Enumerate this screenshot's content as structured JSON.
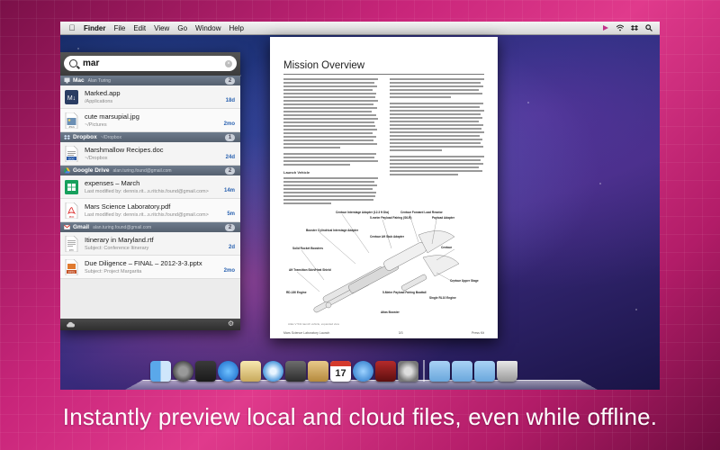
{
  "menubar": {
    "items": [
      "Finder",
      "File",
      "Edit",
      "View",
      "Go",
      "Window",
      "Help"
    ]
  },
  "search": {
    "query": "mar"
  },
  "groups": [
    {
      "name": "Mac",
      "account": "Alan Turing",
      "count": "2",
      "icon": "mac-icon",
      "results": [
        {
          "title": "Marked.app",
          "subtitle": "/Applications",
          "age": "18d",
          "icon": "app-icon"
        },
        {
          "title": "cute marsupial.jpg",
          "subtitle": "~/Pictures",
          "age": "2mo",
          "icon": "image-file-icon"
        }
      ]
    },
    {
      "name": "Dropbox",
      "account": "~/Dropbox",
      "count": "1",
      "icon": "dropbox-icon",
      "results": [
        {
          "title": "Marshmallow Recipes.doc",
          "subtitle": "~/Dropbox",
          "age": "24d",
          "icon": "word-doc-icon"
        }
      ]
    },
    {
      "name": "Google Drive",
      "account": "alan.turing.found@gmail.com",
      "count": "2",
      "icon": "google-drive-icon",
      "results": [
        {
          "title": "expenses – March",
          "subtitle": "Last modified by: dennis.rit...s.ritchis.found@gmail.com>",
          "age": "14m",
          "icon": "spreadsheet-icon"
        },
        {
          "title": "Mars Science Laboratory.pdf",
          "subtitle": "Last modified by: dennis.rit...s.ritchis.found@gmail.com>",
          "age": "5m",
          "icon": "pdf-file-icon"
        }
      ]
    },
    {
      "name": "Gmail",
      "account": "alan.turing.found@gmail.com",
      "count": "2",
      "icon": "gmail-icon",
      "results": [
        {
          "title": "Itinerary in Maryland.rtf",
          "subtitle": "Subject: Conference Itinerary",
          "age": "2d",
          "icon": "rtf-file-icon"
        },
        {
          "title": "Due Diligence – FINAL – 2012-3-3.pptx",
          "subtitle": "Subject: Project Margarita",
          "age": "2mo",
          "icon": "pptx-file-icon"
        }
      ]
    }
  ],
  "preview": {
    "title": "Mission Overview",
    "subhead": "Launch Vehicle",
    "caption": "Atlas V 541 launch vehicle, expanded view",
    "footer_left": "Mars Science Laboratory Launch",
    "footer_mid": "3/3",
    "footer_right": "Press Kit",
    "figure_labels": [
      "Centaur Interstage Adapter (12.3 ft Dia)",
      "5-meter Payload Fairing (S6-R)",
      "Centaur Forward Load Reactor",
      "Payload Adapter",
      "Booster Cylindrical Interstage Adapter",
      "Centaur Aft Stub Adapter",
      "Solid Rocket Boosters",
      "Aft Transition Skirt/Heat Shield",
      "RD-180 Engine",
      "Centaur",
      "Centaur Upper Stage",
      "5-Meter Payload Fairing Boattail",
      "Single RL10 Engine",
      "Atlas Booster"
    ]
  },
  "caption": "Instantly preview local and cloud files, even while offline.",
  "dock": {
    "icons": [
      "finder-icon",
      "launchpad-icon",
      "mission-control-icon",
      "app-store-icon",
      "preview-icon",
      "safari-icon",
      "facetime-icon",
      "mail-icon",
      "calendar-icon",
      "itunes-icon",
      "photo-booth-icon",
      "system-preferences-icon",
      "applications-folder-icon",
      "documents-folder-icon",
      "downloads-folder-icon",
      "trash-icon"
    ],
    "calendar_day": "17"
  }
}
